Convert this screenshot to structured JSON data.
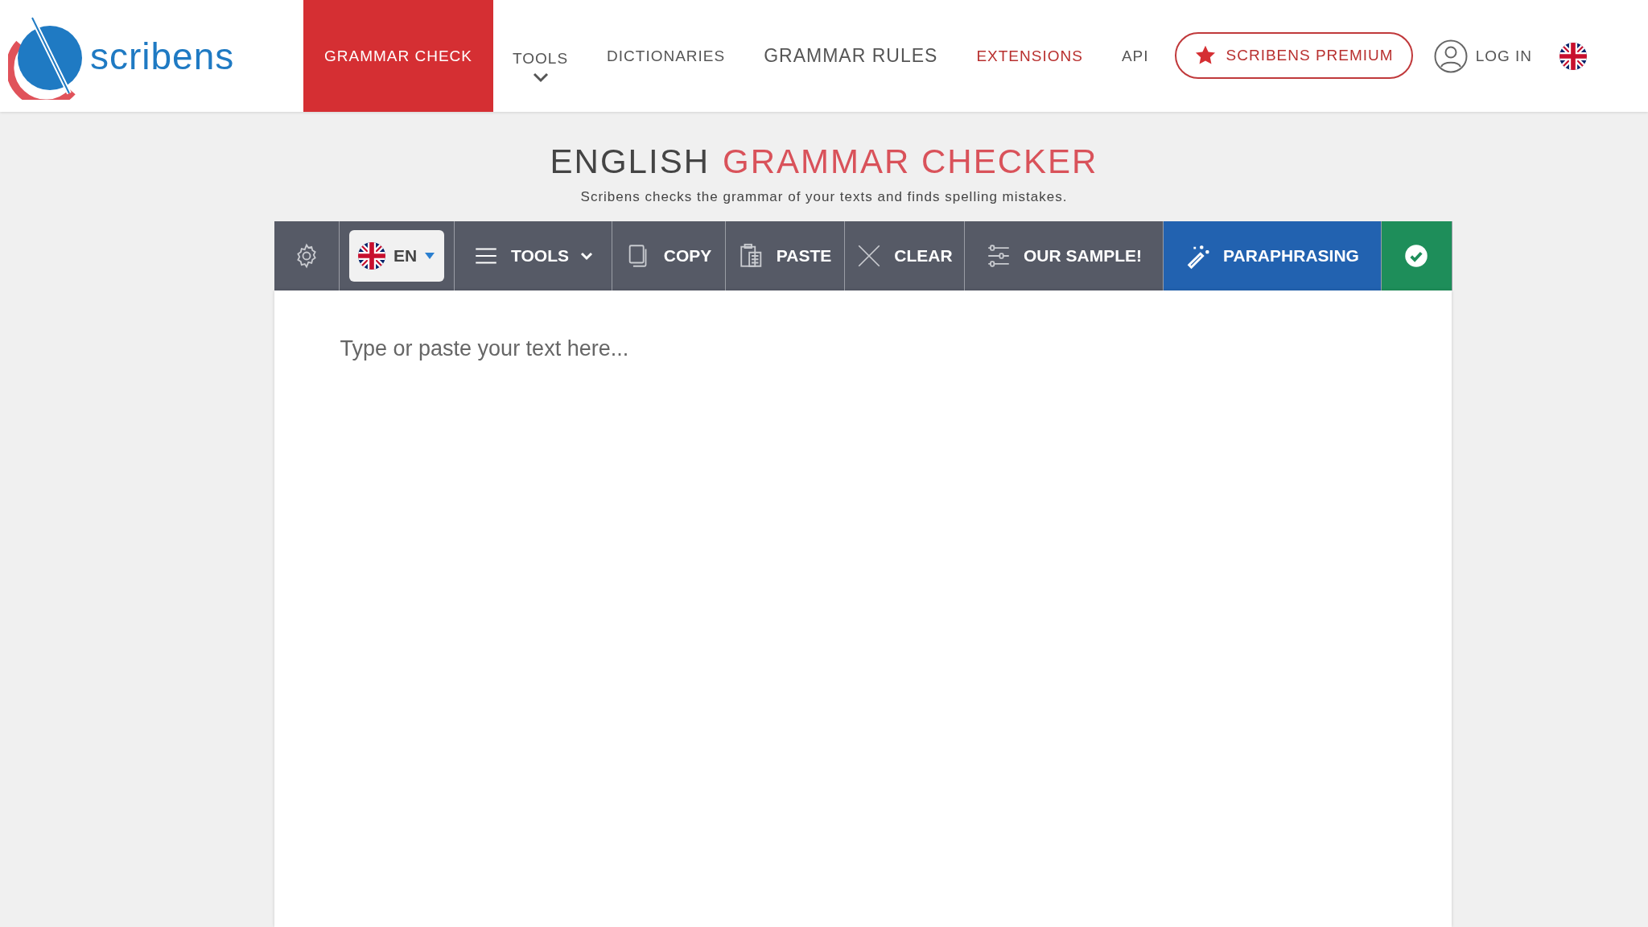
{
  "logo": {
    "text": "scribens"
  },
  "nav": [
    {
      "label": "GRAMMAR CHECK",
      "selected": true,
      "kind": "link"
    },
    {
      "label": "TOOLS",
      "selected": false,
      "kind": "dropdown"
    },
    {
      "label": "DICTIONARIES",
      "selected": false,
      "kind": "link"
    },
    {
      "label": "GRAMMAR RULES",
      "selected": false,
      "kind": "large"
    },
    {
      "label": "EXTENSIONS",
      "selected": false,
      "kind": "accent"
    },
    {
      "label": "API",
      "selected": false,
      "kind": "link"
    }
  ],
  "premium": {
    "label": "SCRIBENS PREMIUM"
  },
  "login": {
    "label": "LOG IN"
  },
  "heading": {
    "first": "ENGLISH",
    "second": "GRAMMAR CHECKER",
    "subtitle": "Scribens checks the grammar of your texts and finds spelling mistakes."
  },
  "toolbar": [
    {
      "kind": "settings"
    },
    {
      "kind": "language",
      "label": "EN"
    },
    {
      "kind": "menu",
      "label": "TOOLS"
    },
    {
      "kind": "copy",
      "label": "COPY"
    },
    {
      "kind": "paste",
      "label": "PASTE"
    },
    {
      "kind": "clear",
      "label": "CLEAR"
    },
    {
      "kind": "sample",
      "label": "OUR SAMPLE!"
    },
    {
      "kind": "paraphrase",
      "label": "PARAPHRASING"
    },
    {
      "kind": "check"
    }
  ],
  "editor": {
    "placeholder": "Type or paste your text here..."
  }
}
